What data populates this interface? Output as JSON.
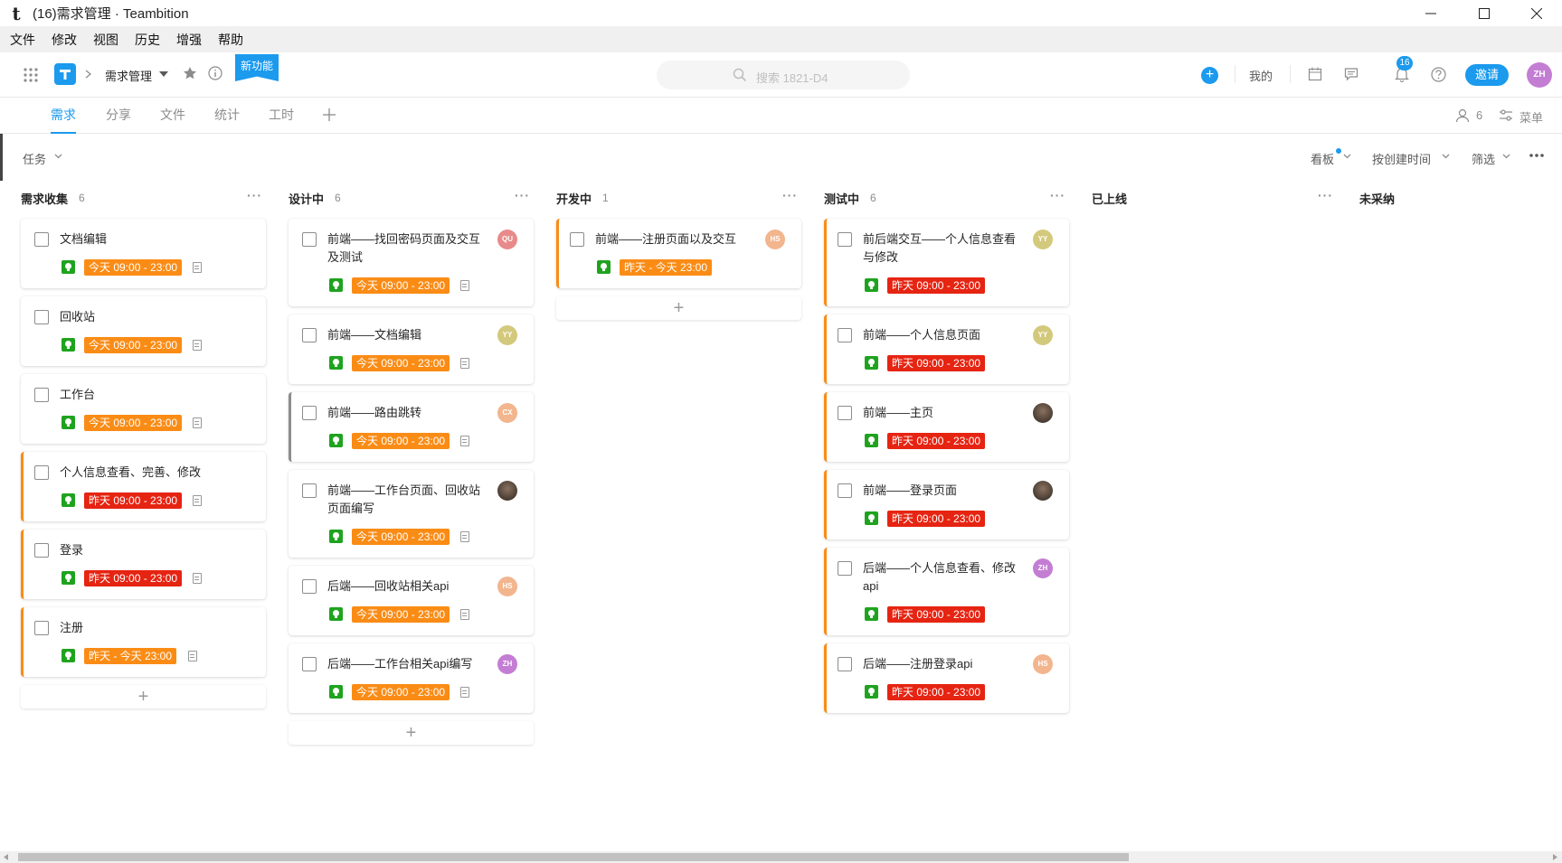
{
  "window": {
    "title": "(16)需求管理 · Teambition",
    "logo": "t"
  },
  "menu": [
    "文件",
    "修改",
    "视图",
    "历史",
    "增强",
    "帮助"
  ],
  "header": {
    "project_name": "需求管理",
    "new_feature_badge": "新功能",
    "search_placeholder": "搜索 1821-D4",
    "mine_label": "我的",
    "notification_count": "16",
    "invite_label": "邀请",
    "user_initials": "ZH"
  },
  "tabs": [
    "需求",
    "分享",
    "文件",
    "统计",
    "工时"
  ],
  "tabs_right": {
    "member_count": "6",
    "menu_label": "菜单"
  },
  "toolbar": {
    "task_filter": "任务",
    "view_label": "看板",
    "sort_label": "按创建时间",
    "filter_label": "筛选"
  },
  "columns": [
    {
      "name": "需求收集",
      "count": "6",
      "cards": [
        {
          "title": "文档编辑",
          "date": "今天 09:00 - 23:00"
        },
        {
          "title": "回收站",
          "date": "今天 09:00 - 23:00"
        },
        {
          "title": "工作台",
          "date": "今天 09:00 - 23:00"
        },
        {
          "title": "个人信息查看、完善、修改",
          "date": "昨天 09:00 - 23:00"
        },
        {
          "title": "登录",
          "date": "昨天 09:00 - 23:00"
        },
        {
          "title": "注册",
          "date": "昨天 - 今天 23:00"
        }
      ]
    },
    {
      "name": "设计中",
      "count": "6",
      "cards": [
        {
          "title": "前端——找回密码页面及交互及测试",
          "date": "今天 09:00 - 23:00",
          "avatar": "QU"
        },
        {
          "title": "前端——文档编辑",
          "date": "今天 09:00 - 23:00",
          "avatar": "YY"
        },
        {
          "title": "前端——路由跳转",
          "date": "今天 09:00 - 23:00",
          "avatar": "CX"
        },
        {
          "title": "前端——工作台页面、回收站页面编写",
          "date": "今天 09:00 - 23:00",
          "avatar": ""
        },
        {
          "title": "后端——回收站相关api",
          "date": "今天 09:00 - 23:00",
          "avatar": "HS"
        },
        {
          "title": "后端——工作台相关api编写",
          "date": "今天 09:00 - 23:00",
          "avatar": "ZH"
        }
      ]
    },
    {
      "name": "开发中",
      "count": "1",
      "cards": [
        {
          "title": "前端——注册页面以及交互",
          "date": "昨天 - 今天 23:00",
          "avatar": "HS"
        }
      ]
    },
    {
      "name": "测试中",
      "count": "6",
      "cards": [
        {
          "title": "前后端交互——个人信息查看与修改",
          "date": "昨天 09:00 - 23:00",
          "avatar": "YY"
        },
        {
          "title": "前端——个人信息页面",
          "date": "昨天 09:00 - 23:00",
          "avatar": "YY"
        },
        {
          "title": "前端——主页",
          "date": "昨天 09:00 - 23:00",
          "avatar": ""
        },
        {
          "title": "前端——登录页面",
          "date": "昨天 09:00 - 23:00",
          "avatar": ""
        },
        {
          "title": "后端——个人信息查看、修改api",
          "date": "昨天 09:00 - 23:00",
          "avatar": "ZH"
        },
        {
          "title": "后端——注册登录api",
          "date": "昨天 09:00 - 23:00",
          "avatar": "HS"
        }
      ]
    },
    {
      "name": "已上线",
      "count": "",
      "cards": []
    },
    {
      "name": "未采纳",
      "count": "",
      "cards": []
    }
  ],
  "colors": {
    "accent": "#1b9aee",
    "date_today": "#fa8c16",
    "date_overdue": "#e62412",
    "bulb": "#1fa31f",
    "priority_bar": "#fa8c16"
  }
}
